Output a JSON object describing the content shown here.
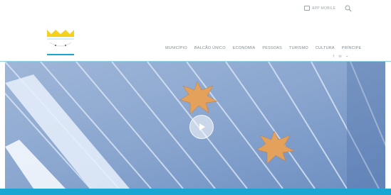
{
  "topbar": {
    "app_label": "APP MOBILE",
    "icons": [
      "mobile-app-icon",
      "search-icon"
    ]
  },
  "logo": {
    "caption_line1": "ADMINISTRAÇÃO",
    "caption_line2": "PENEDO DA COLINA"
  },
  "nav": {
    "items": [
      "MUNICÍPIO",
      "BALCÃO ÚNICO",
      "ECONOMIA",
      "PESSOAS",
      "TURISMO",
      "CULTURA",
      "PRÍNCIPE"
    ]
  },
  "social": {
    "items": [
      "f",
      "✉",
      "⌁"
    ],
    "icons": [
      "facebook-icon",
      "email-icon",
      "rss-icon"
    ]
  },
  "hero": {
    "play_icon": "play-icon"
  },
  "colors": {
    "accent": "#1aa6d3",
    "divider": "#8ed2e6",
    "nav_text": "#7f8a90"
  }
}
